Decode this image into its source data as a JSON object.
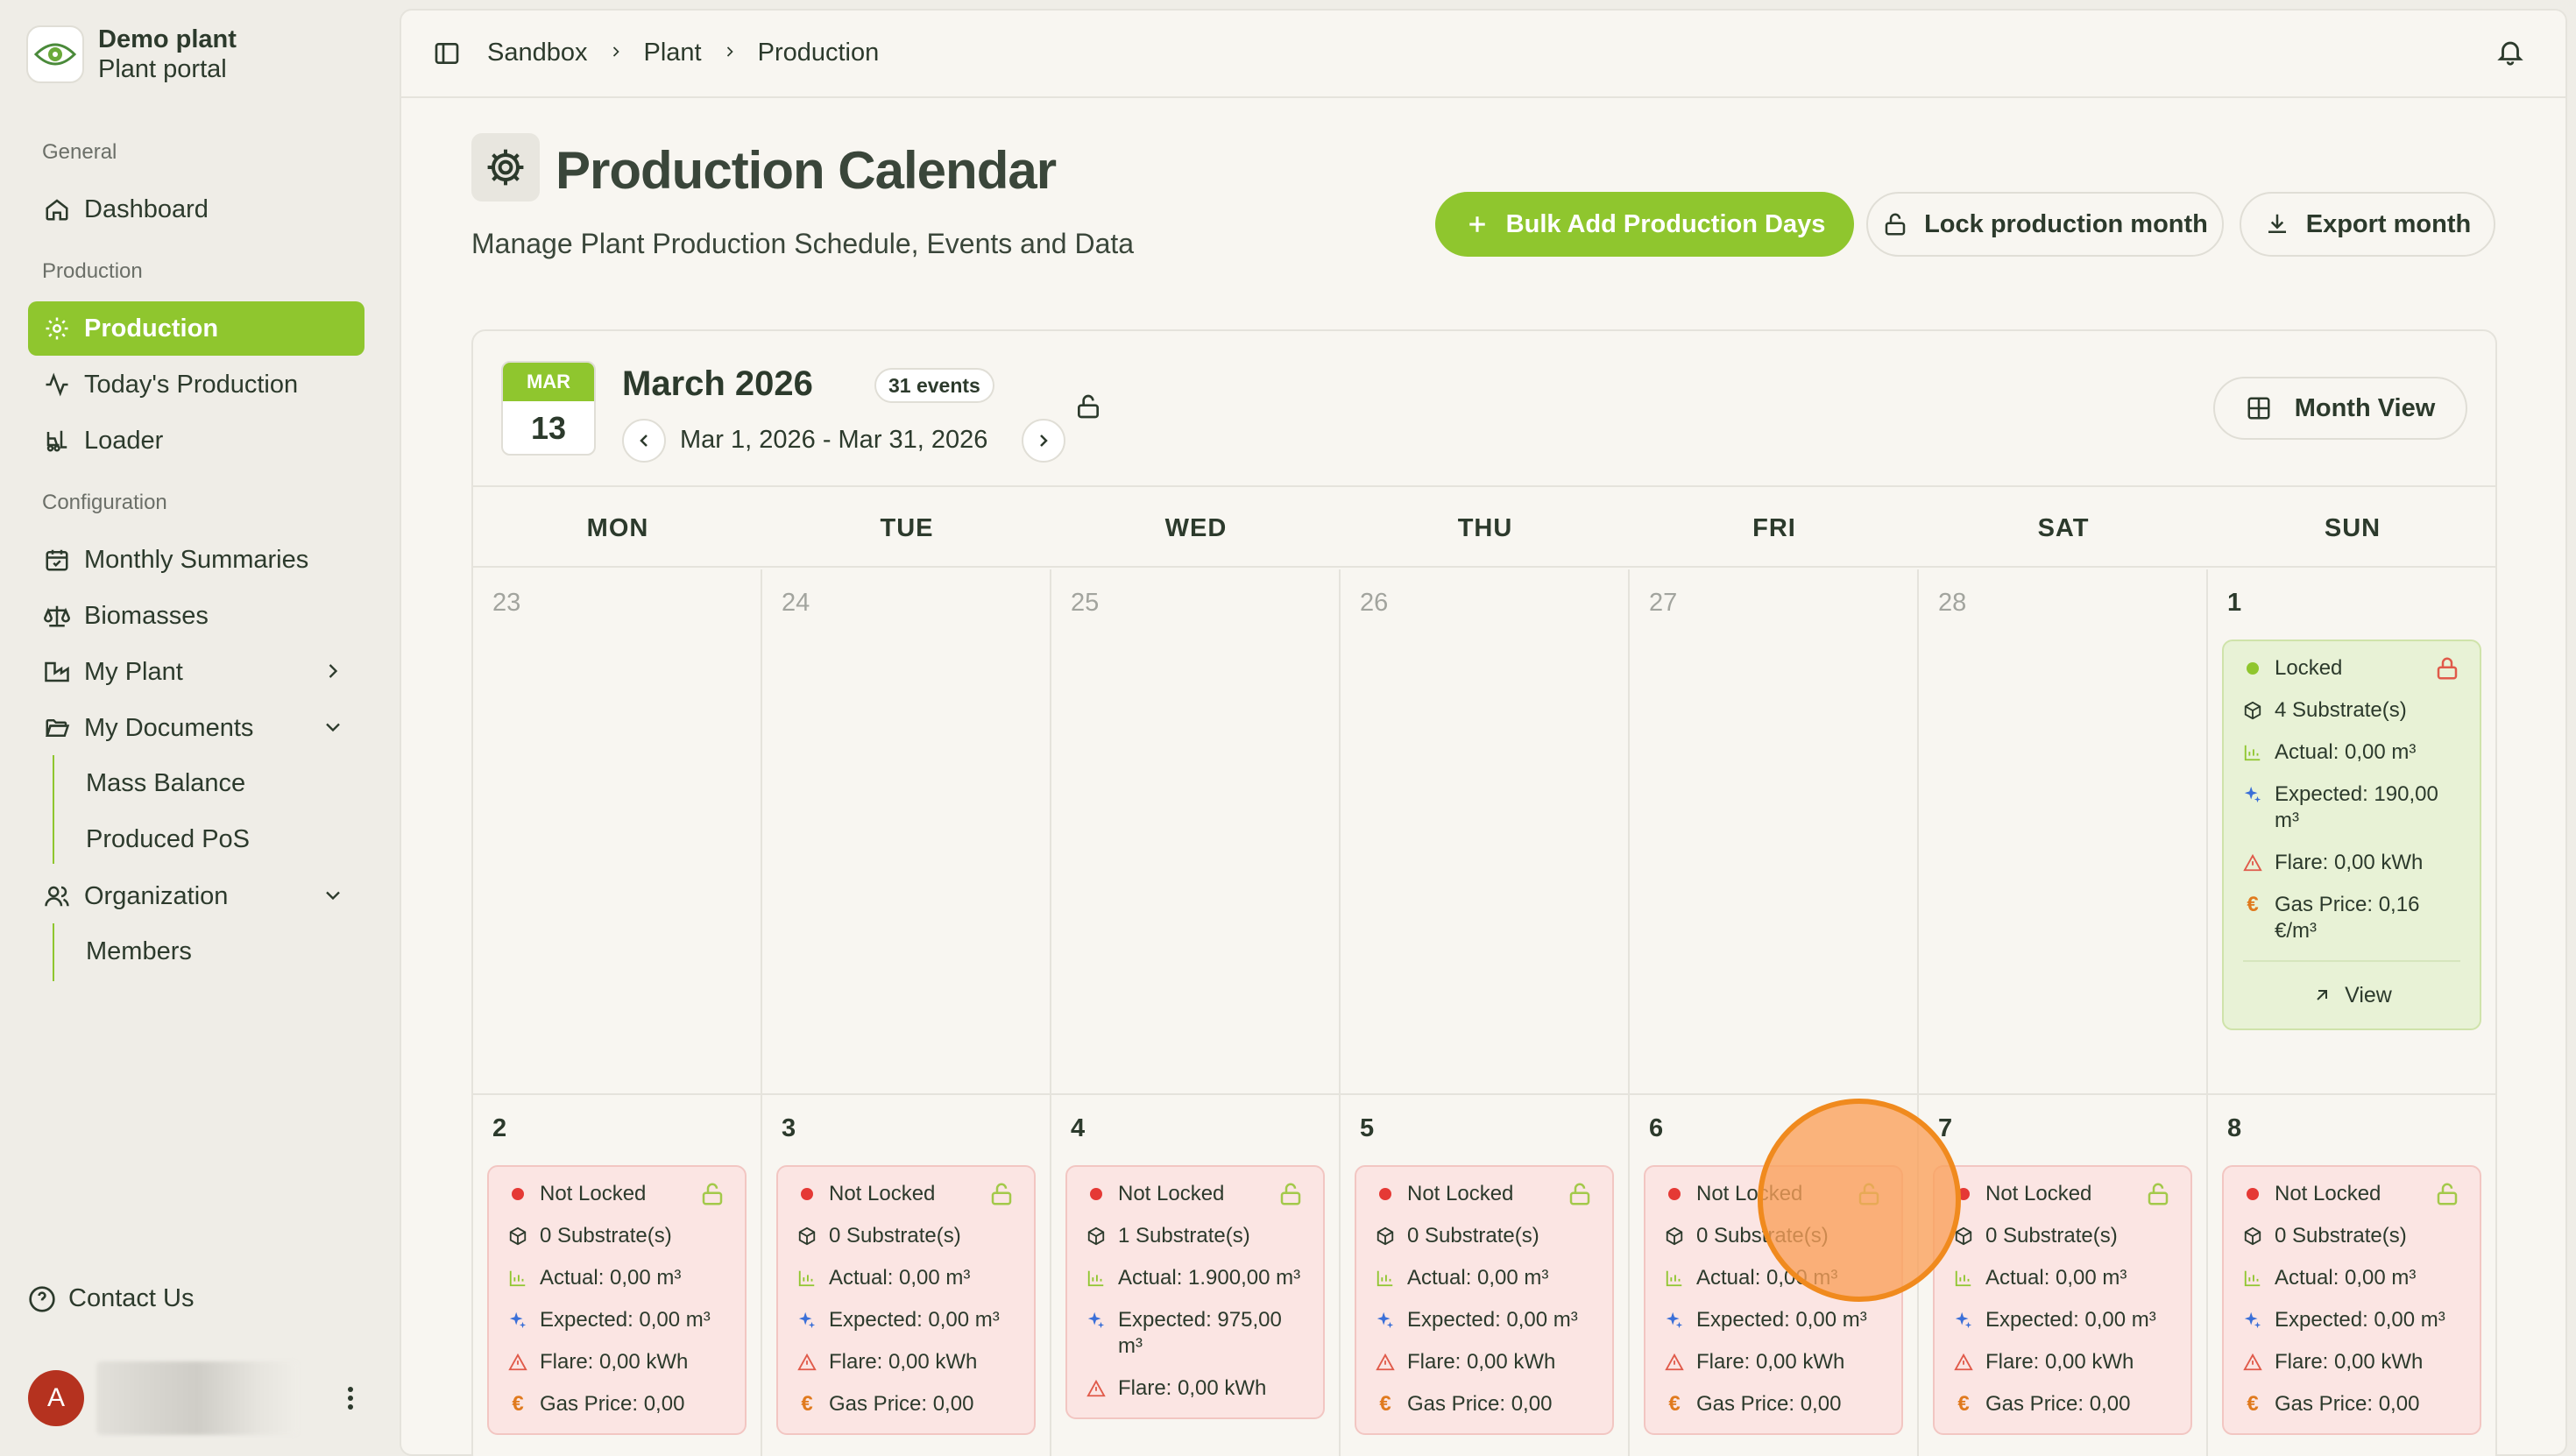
{
  "brand": {
    "title": "Demo plant",
    "subtitle": "Plant portal"
  },
  "sidebar": {
    "section_general": "General",
    "section_production": "Production",
    "section_configuration": "Configuration",
    "dashboard": "Dashboard",
    "production": "Production",
    "todays_production": "Today's Production",
    "loader": "Loader",
    "monthly_summaries": "Monthly Summaries",
    "biomasses": "Biomasses",
    "my_plant": "My Plant",
    "my_documents": "My Documents",
    "mass_balance": "Mass Balance",
    "produced_pos": "Produced PoS",
    "organization": "Organization",
    "members": "Members",
    "contact_us": "Contact Us",
    "avatar_initial": "A"
  },
  "breadcrumb": [
    "Sandbox",
    "Plant",
    "Production"
  ],
  "page": {
    "title": "Production Calendar",
    "subtitle": "Manage Plant Production Schedule, Events and Data",
    "bulk_add": "Bulk Add Production Days",
    "lock_month": "Lock production month",
    "export_month": "Export month"
  },
  "calendar": {
    "chip_month": "MAR",
    "chip_day": "13",
    "title": "March 2026",
    "events_count": "31 events",
    "range": "Mar 1, 2026 - Mar 31, 2026",
    "view_mode": "Month View",
    "weekdays": [
      "MON",
      "TUE",
      "WED",
      "THU",
      "FRI",
      "SAT",
      "SUN"
    ],
    "week1_days": [
      "23",
      "24",
      "25",
      "26",
      "27",
      "28",
      "1"
    ],
    "week2_days": [
      "2",
      "3",
      "4",
      "5",
      "6",
      "7",
      "8"
    ],
    "events": {
      "mar1": {
        "status": "Locked",
        "substrates": "4 Substrate(s)",
        "actual": "Actual: 0,00 m³",
        "expected": "Expected: 190,00 m³",
        "flare": "Flare: 0,00 kWh",
        "gas_price": "Gas Price: 0,16 €/m³",
        "view": "View"
      },
      "mar2": {
        "status": "Not Locked",
        "substrates": "0 Substrate(s)",
        "actual": "Actual: 0,00 m³",
        "expected": "Expected: 0,00 m³",
        "flare": "Flare: 0,00 kWh",
        "gas_price": "Gas Price: 0,00"
      },
      "mar3": {
        "status": "Not Locked",
        "substrates": "0 Substrate(s)",
        "actual": "Actual: 0,00 m³",
        "expected": "Expected: 0,00 m³",
        "flare": "Flare: 0,00 kWh",
        "gas_price": "Gas Price: 0,00"
      },
      "mar4": {
        "status": "Not Locked",
        "substrates": "1 Substrate(s)",
        "actual": "Actual: 1.900,00 m³",
        "expected": "Expected: 975,00 m³",
        "flare": "Flare: 0,00 kWh"
      },
      "mar5": {
        "status": "Not Locked",
        "substrates": "0 Substrate(s)",
        "actual": "Actual: 0,00 m³",
        "expected": "Expected: 0,00 m³",
        "flare": "Flare: 0,00 kWh",
        "gas_price": "Gas Price: 0,00"
      },
      "mar6": {
        "status": "Not Locked",
        "substrates": "0 Substrate(s)",
        "actual": "Actual: 0,00 m³",
        "expected": "Expected: 0,00 m³",
        "flare": "Flare: 0,00 kWh",
        "gas_price": "Gas Price: 0,00"
      },
      "mar7": {
        "status": "Not Locked",
        "substrates": "0 Substrate(s)",
        "actual": "Actual: 0,00 m³",
        "expected": "Expected: 0,00 m³",
        "flare": "Flare: 0,00 kWh",
        "gas_price": "Gas Price: 0,00"
      },
      "mar8": {
        "status": "Not Locked",
        "substrates": "0 Substrate(s)",
        "actual": "Actual: 0,00 m³",
        "expected": "Expected: 0,00 m³",
        "flare": "Flare: 0,00 kWh",
        "gas_price": "Gas Price: 0,00"
      }
    }
  },
  "colors": {
    "accent": "#8fc62e",
    "locked_dot": "#8fc62e",
    "not_locked_dot": "#e53935",
    "lock_icon_open": "#a3c94a",
    "lock_icon_closed": "#e05a4a"
  }
}
